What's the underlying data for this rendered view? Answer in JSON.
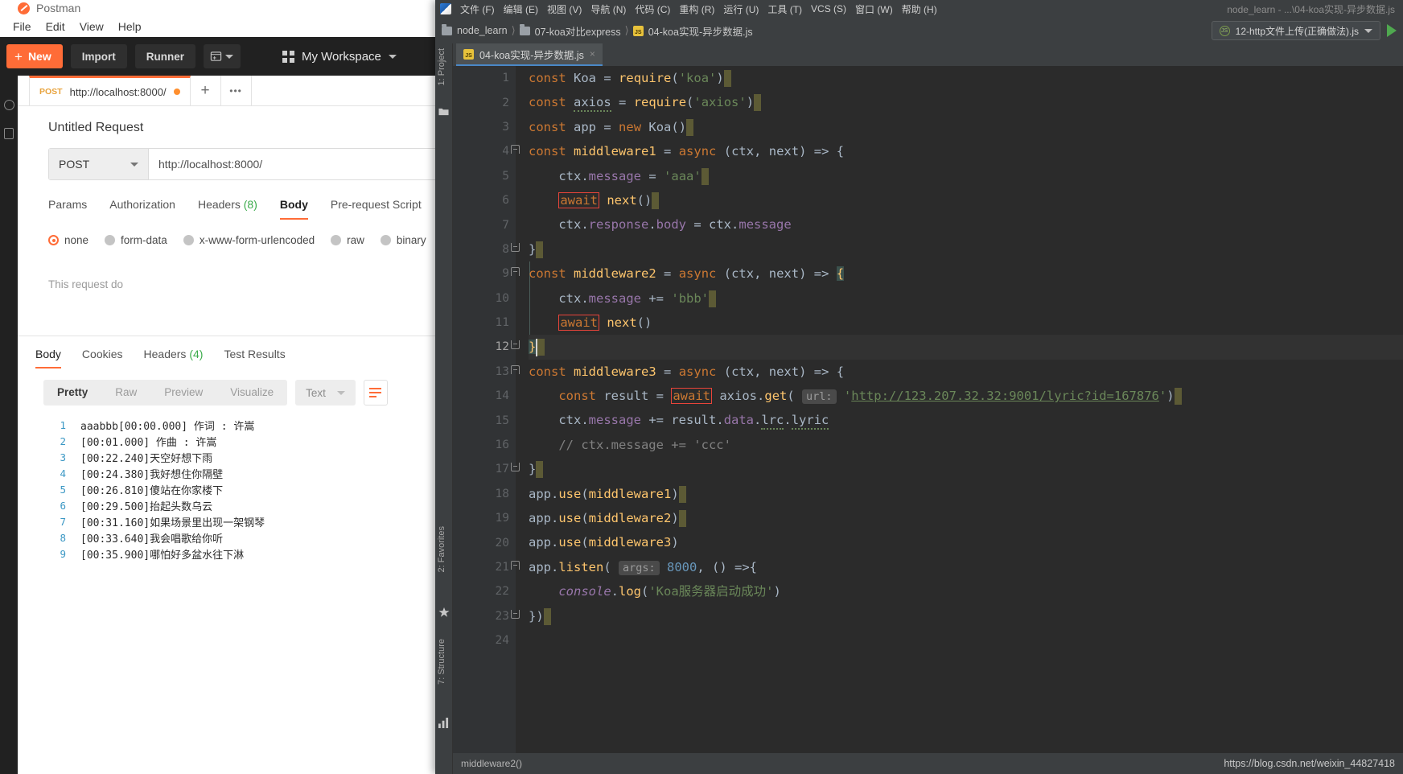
{
  "postman": {
    "window_title": "Postman",
    "logo_icon": "postman-logo-icon",
    "menu": [
      "File",
      "Edit",
      "View",
      "Help"
    ],
    "toolbar": {
      "new_label": "New",
      "import_label": "Import",
      "runner_label": "Runner",
      "new_window_icon": "new-window-icon",
      "workspace_label": "My Workspace",
      "grid_icon": "grid-icon",
      "chevron_icon": "chevron-down-icon"
    },
    "tab": {
      "method": "POST",
      "url": "http://localhost:8000/",
      "unsaved_dot": "unsaved-dot",
      "add_label": "+",
      "more_label": "•••"
    },
    "request": {
      "name": "Untitled Request",
      "method": "POST",
      "url_value": "http://localhost:8000/",
      "tabs": [
        {
          "label": "Params",
          "active": false
        },
        {
          "label": "Authorization",
          "active": false
        },
        {
          "label": "Headers",
          "count": "(8)",
          "active": false
        },
        {
          "label": "Body",
          "active": true
        },
        {
          "label": "Pre-request Script",
          "active": false
        }
      ],
      "body_types": [
        {
          "label": "none",
          "selected": true
        },
        {
          "label": "form-data",
          "selected": false
        },
        {
          "label": "x-www-form-urlencoded",
          "selected": false
        },
        {
          "label": "raw",
          "selected": false
        },
        {
          "label": "binary",
          "selected": false
        }
      ],
      "hint": "This request do"
    },
    "response": {
      "tabs": [
        {
          "label": "Body",
          "active": true
        },
        {
          "label": "Cookies",
          "active": false
        },
        {
          "label": "Headers",
          "count": "(4)",
          "active": false
        },
        {
          "label": "Test Results",
          "active": false
        }
      ],
      "view_modes": [
        {
          "label": "Pretty",
          "active": true
        },
        {
          "label": "Raw",
          "active": false
        },
        {
          "label": "Preview",
          "active": false
        },
        {
          "label": "Visualize",
          "active": false
        }
      ],
      "format_label": "Text",
      "format_caret": "chevron-down-icon",
      "wrap_icon": "word-wrap-icon",
      "lines": [
        {
          "n": "1",
          "text": "aaabbb[00:00.000] 作词 : 许嵩"
        },
        {
          "n": "2",
          "text": "[00:01.000] 作曲 : 许嵩"
        },
        {
          "n": "3",
          "text": "[00:22.240]天空好想下雨"
        },
        {
          "n": "4",
          "text": "[00:24.380]我好想住你隔壁"
        },
        {
          "n": "5",
          "text": "[00:26.810]傻站在你家楼下"
        },
        {
          "n": "6",
          "text": "[00:29.500]抬起头数乌云"
        },
        {
          "n": "7",
          "text": "[00:31.160]如果场景里出现一架钢琴"
        },
        {
          "n": "8",
          "text": "[00:33.640]我会唱歌给你听"
        },
        {
          "n": "9",
          "text": "[00:35.900]哪怕好多盆水往下淋"
        }
      ]
    }
  },
  "ide": {
    "app_icon": "webstorm-icon",
    "menu": [
      "文件 (F)",
      "编辑 (E)",
      "视图 (V)",
      "导航 (N)",
      "代码 (C)",
      "重构 (R)",
      "运行 (U)",
      "工具 (T)",
      "VCS (S)",
      "窗口 (W)",
      "帮助 (H)"
    ],
    "window_path": "node_learn - ...\\04-koa实现-异步数据.js",
    "breadcrumbs": [
      {
        "label": "node_learn",
        "icon": "folder-icon"
      },
      {
        "label": "07-koa对比express",
        "icon": "folder-icon"
      },
      {
        "label": "04-koa实现-异步数据.js",
        "icon": "js-file-icon"
      }
    ],
    "run_config": "12-http文件上传(正确做法).js",
    "run_config_icon": "run-config-icon",
    "run_caret": "chevron-down-icon",
    "run_button_icon": "play-icon",
    "editor_tab": {
      "label": "04-koa实现-异步数据.js",
      "icon": "js-file-icon",
      "close": "×"
    },
    "left_rail": [
      "1: Project",
      "2: Favorites",
      "7: Structure"
    ],
    "left_rail_icons": [
      "project-folder-icon",
      "favorites-star-icon",
      "structure-icon"
    ],
    "status_text": "middleware2()",
    "watermark": "https://blog.csdn.net/weixin_44827418",
    "code_url": "http://123.207.32.32:9001/lyric?id=167876",
    "line_numbers": [
      "1",
      "2",
      "3",
      "4",
      "5",
      "6",
      "7",
      "8",
      "9",
      "10",
      "11",
      "12",
      "13",
      "14",
      "15",
      "16",
      "17",
      "18",
      "19",
      "20",
      "21",
      "22",
      "23",
      "24"
    ],
    "current_line": "12",
    "hint_url_label": "url:",
    "hint_args_label": "args:"
  }
}
